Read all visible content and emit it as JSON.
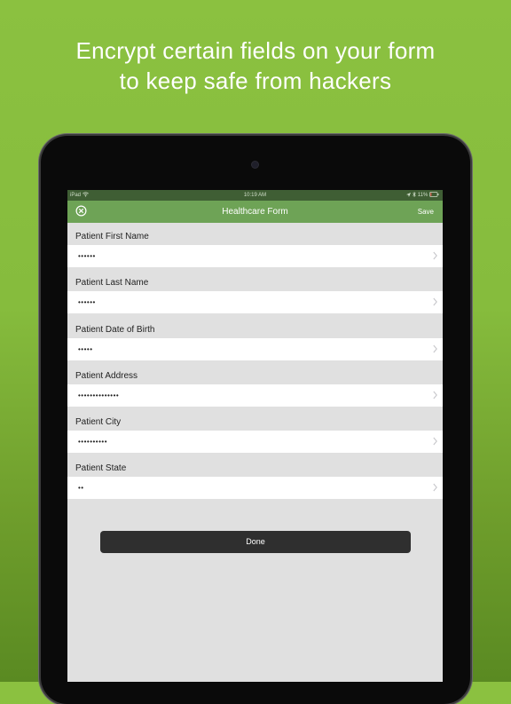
{
  "headline": {
    "line1": "Encrypt certain fields on your form",
    "line2": "to keep safe from hackers"
  },
  "status_bar": {
    "carrier": "iPad",
    "time": "10:19 AM",
    "battery": "11%"
  },
  "nav": {
    "close_icon": "close-circle-icon",
    "title": "Healthcare Form",
    "save_label": "Save"
  },
  "fields": [
    {
      "label": "Patient First Name",
      "value": "••••••"
    },
    {
      "label": "Patient Last Name",
      "value": "••••••"
    },
    {
      "label": "Patient Date of Birth",
      "value": "•••••"
    },
    {
      "label": "Patient Address",
      "value": "••••••••••••••"
    },
    {
      "label": "Patient City",
      "value": "••••••••••"
    },
    {
      "label": "Patient State",
      "value": "••"
    }
  ],
  "done_label": "Done",
  "colors": {
    "background": "#86bc3d",
    "nav_bar": "#6ea356",
    "status_bar": "#3f5e34",
    "done_button": "#2f2f2f"
  }
}
